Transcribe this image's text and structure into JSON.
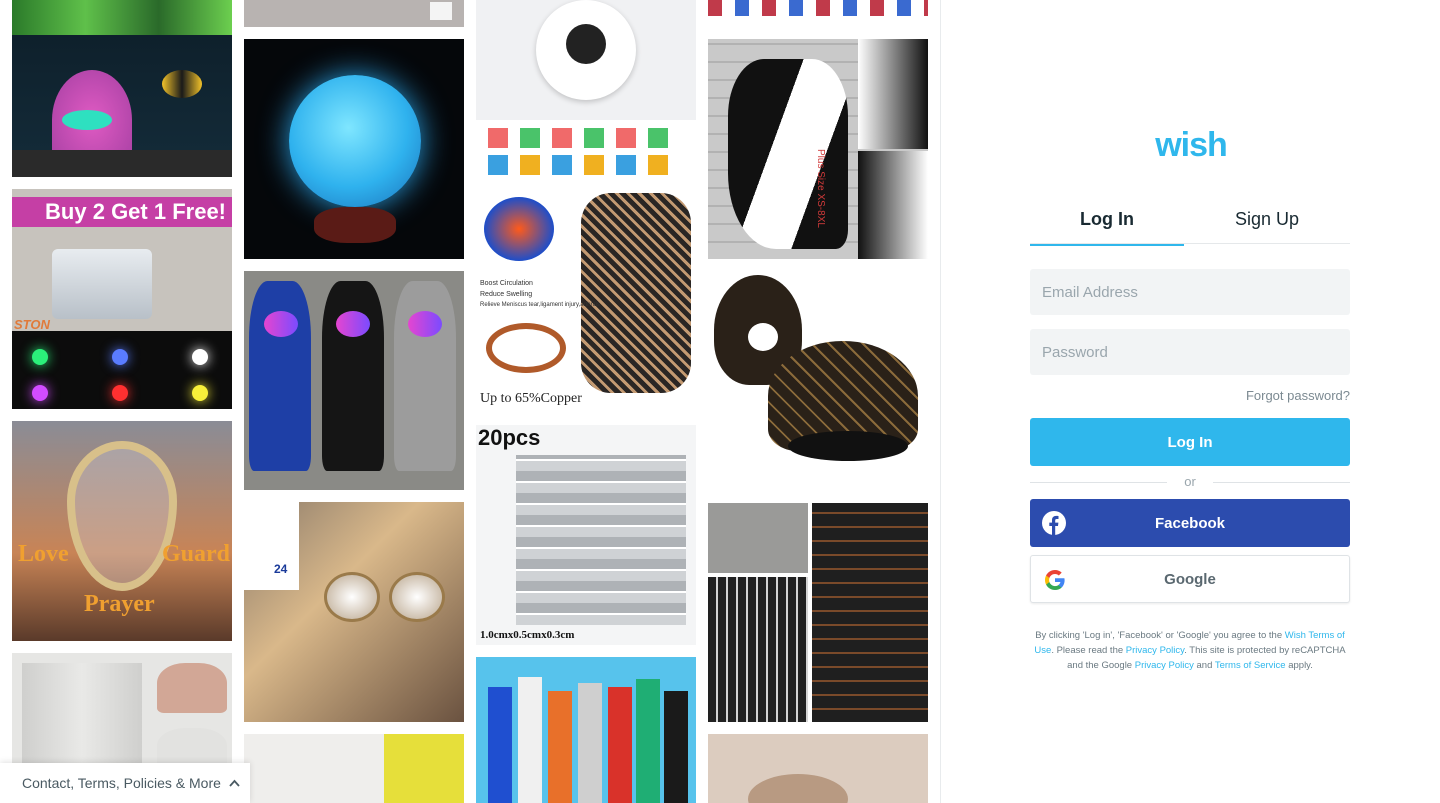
{
  "brand": {
    "logo_text": "wish",
    "color": "#2fb7ec"
  },
  "tabs": {
    "login": "Log In",
    "signup": "Sign Up"
  },
  "form": {
    "email_placeholder": "Email Address",
    "password_placeholder": "Password",
    "forgot": "Forgot password?",
    "login_button": "Log In",
    "or": "or",
    "facebook_button": "Facebook",
    "google_button": "Google"
  },
  "legal": {
    "p1": "By clicking 'Log in', 'Facebook' or 'Google' you agree to the ",
    "link_terms": "Wish Terms of Use",
    "p2": ". Please read the ",
    "link_privacy": "Privacy Policy",
    "p3": ". This site is protected by reCAPTCHA and the Google ",
    "link_google_privacy": "Privacy Policy",
    "p4": " and ",
    "link_google_tos": "Terms of Service",
    "p5": " apply."
  },
  "footer": {
    "links_label": "Contact, Terms, Policies & More"
  },
  "product_tiles": {
    "promo_banner": "Buy 2 Get 1 Free!",
    "usb_brand": "STON",
    "pendant_words": [
      "Love",
      "Guard",
      "Prayer"
    ],
    "knee_caption": "Up to 65%Copper",
    "knee_bullets": [
      "Boost Circulation",
      "Reduce Swelling",
      "Relieve Meniscus tear,ligament injury,arthritis"
    ],
    "magnets_count": "20pcs",
    "magnets_size": "1.0cmx0.5cmx0.3cm",
    "shirt_side_text": "Plus Size XS-8XL",
    "sunglasses_badge": "24"
  },
  "colors": {
    "facebook": "#2c4cae",
    "primary": "#2fb7ec",
    "field_bg": "#f2f4f5"
  }
}
